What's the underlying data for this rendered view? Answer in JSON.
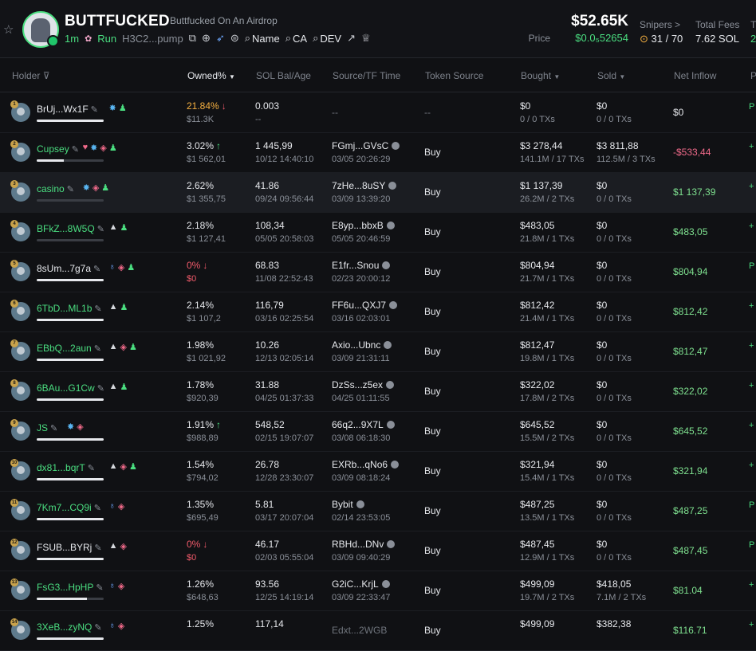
{
  "token": {
    "name": "BUTTFUCKED",
    "full_name": "Buttfucked On An Airdrop",
    "age": "1m",
    "run_label": "Run",
    "ca_short": "H3C2...pump",
    "links": {
      "name": "Name",
      "ca": "CA",
      "dev": "DEV"
    }
  },
  "stats": {
    "market_cap": "$52.65K",
    "price_label": "Price",
    "price_value": "$0.0₅52654",
    "snipers_label": "Snipers >",
    "snipers_value": "31 / 70",
    "fees_label": "Total Fees",
    "fees_value": "7.62 SOL",
    "cut_label": "T",
    "cut_value": "2"
  },
  "table": {
    "headers": {
      "holder": "Holder",
      "owned": "Owned%",
      "sol_bal": "SOL Bal/Age",
      "source": "Source/TF Time",
      "token_source": "Token Source",
      "bought": "Bought",
      "sold": "Sold",
      "net_inflow": "Net Inflow",
      "cut": "P"
    },
    "rows": [
      {
        "rank": "1",
        "name": "BrUj...Wx1F",
        "green": false,
        "bar": 100,
        "tags": [
          "t-blue",
          "t-person"
        ],
        "own": "21.84%",
        "own_cls": "own-orange",
        "own_arrow": "down",
        "own_usd": "$11.3K",
        "sol": "0.003",
        "age": "--",
        "src": "--",
        "tf_time": "",
        "tsrc": "--",
        "bought": "$0",
        "bought_sub": "0 / 0 TXs",
        "sold": "$0",
        "sold_sub": "0 / 0 TXs",
        "net": "$0",
        "net_cls": "net-zero",
        "edge": "P"
      },
      {
        "rank": "2",
        "name": "Cupsey",
        "green": true,
        "bar": 40,
        "tags": [
          "t-heart",
          "t-blue",
          "t-stack",
          "t-person"
        ],
        "own": "3.02%",
        "own_cls": "",
        "own_arrow": "up",
        "own_usd": "$1 562,01",
        "sol": "1 445,99",
        "age": "10/12 14:40:10",
        "src": "FGmj...GVsC",
        "tf_time": "03/05 20:26:29",
        "tsrc": "Buy",
        "bought": "$3 278,44",
        "bought_sub": "141.1M / 17 TXs",
        "sold": "$3 811,88",
        "sold_sub": "112.5M / 3 TXs",
        "net": "-$533,44",
        "net_cls": "net-neg",
        "edge": "+"
      },
      {
        "rank": "3",
        "name": "casino",
        "green": true,
        "bar": 0,
        "tags": [
          "t-blue",
          "t-stack",
          "t-person"
        ],
        "own": "2.62%",
        "own_cls": "",
        "own_arrow": "",
        "own_usd": "$1 355,75",
        "sol": "41.86",
        "age": "09/24 09:56:44",
        "src": "7zHe...8uSY",
        "tf_time": "03/09 13:39:20",
        "tsrc": "Buy",
        "bought": "$1 137,39",
        "bought_sub": "26.2M / 2 TXs",
        "sold": "$0",
        "sold_sub": "0 / 0 TXs",
        "net": "$1 137,39",
        "net_cls": "net-pos",
        "edge": "+"
      },
      {
        "rank": "4",
        "name": "BFkZ...8W5Q",
        "green": true,
        "bar": 0,
        "tags": [
          "t-cap",
          "t-person"
        ],
        "own": "2.18%",
        "own_cls": "",
        "own_arrow": "",
        "own_usd": "$1 127,41",
        "sol": "108,34",
        "age": "05/05 20:58:03",
        "src": "E8yp...bbxB",
        "tf_time": "05/05 20:46:59",
        "tsrc": "Buy",
        "bought": "$483,05",
        "bought_sub": "21.8M / 1 TXs",
        "sold": "$0",
        "sold_sub": "0 / 0 TXs",
        "net": "$483,05",
        "net_cls": "net-pos",
        "edge": "+"
      },
      {
        "rank": "5",
        "name": "8sUm...7g7a",
        "green": false,
        "bar": 100,
        "tags": [
          "t-ghost",
          "t-stack",
          "t-person"
        ],
        "own": "0%",
        "own_cls": "own-red",
        "own_arrow": "down",
        "own_usd": "$0",
        "own_usd_red": true,
        "sol": "68.83",
        "age": "11/08 22:52:43",
        "src": "E1fr...Snou",
        "tf_time": "02/23 20:00:12",
        "tsrc": "Buy",
        "bought": "$804,94",
        "bought_sub": "21.7M / 1 TXs",
        "sold": "$0",
        "sold_sub": "0 / 0 TXs",
        "net": "$804,94",
        "net_cls": "net-pos",
        "edge": "P"
      },
      {
        "rank": "6",
        "name": "6TbD...ML1b",
        "green": true,
        "bar": 100,
        "tags": [
          "t-cap",
          "t-person"
        ],
        "own": "2.14%",
        "own_cls": "",
        "own_arrow": "",
        "own_usd": "$1 107,2",
        "sol": "116,79",
        "age": "03/16 02:25:54",
        "src": "FF6u...QXJ7",
        "tf_time": "03/16 02:03:01",
        "tsrc": "Buy",
        "bought": "$812,42",
        "bought_sub": "21.4M / 1 TXs",
        "sold": "$0",
        "sold_sub": "0 / 0 TXs",
        "net": "$812,42",
        "net_cls": "net-pos",
        "edge": "+"
      },
      {
        "rank": "7",
        "name": "EBbQ...2aun",
        "green": true,
        "bar": 100,
        "tags": [
          "t-cap",
          "t-stack",
          "t-person"
        ],
        "own": "1.98%",
        "own_cls": "",
        "own_arrow": "",
        "own_usd": "$1 021,92",
        "sol": "10.26",
        "age": "12/13 02:05:14",
        "src": "Axio...Ubnc",
        "tf_time": "03/09 21:31:11",
        "tsrc": "Buy",
        "bought": "$812,47",
        "bought_sub": "19.8M / 1 TXs",
        "sold": "$0",
        "sold_sub": "0 / 0 TXs",
        "net": "$812,47",
        "net_cls": "net-pos",
        "edge": "+"
      },
      {
        "rank": "8",
        "name": "6BAu...G1Cw",
        "green": true,
        "bar": 100,
        "tags": [
          "t-cap",
          "t-person"
        ],
        "own": "1.78%",
        "own_cls": "",
        "own_arrow": "",
        "own_usd": "$920,39",
        "sol": "31.88",
        "age": "04/25 01:37:33",
        "src": "DzSs...z5ex",
        "tf_time": "04/25 01:11:55",
        "tsrc": "Buy",
        "bought": "$322,02",
        "bought_sub": "17.8M / 2 TXs",
        "sold": "$0",
        "sold_sub": "0 / 0 TXs",
        "net": "$322,02",
        "net_cls": "net-pos",
        "edge": "+"
      },
      {
        "rank": "9",
        "name": "JS",
        "green": true,
        "bar": 100,
        "tags": [
          "t-blue",
          "t-stack"
        ],
        "own": "1.91%",
        "own_cls": "",
        "own_arrow": "up",
        "own_usd": "$988,89",
        "sol": "548,52",
        "age": "02/15 19:07:07",
        "src": "66q2...9X7L",
        "tf_time": "03/08 06:18:30",
        "tsrc": "Buy",
        "bought": "$645,52",
        "bought_sub": "15.5M / 2 TXs",
        "sold": "$0",
        "sold_sub": "0 / 0 TXs",
        "net": "$645,52",
        "net_cls": "net-pos",
        "edge": "+"
      },
      {
        "rank": "10",
        "name": "dx81...bqrT",
        "green": true,
        "bar": 100,
        "tags": [
          "t-cap",
          "t-stack",
          "t-person"
        ],
        "own": "1.54%",
        "own_cls": "",
        "own_arrow": "",
        "own_usd": "$794,02",
        "sol": "26.78",
        "age": "12/28 23:30:07",
        "src": "EXRb...qNo6",
        "tf_time": "03/09 08:18:24",
        "tsrc": "Buy",
        "bought": "$321,94",
        "bought_sub": "15.4M / 1 TXs",
        "sold": "$0",
        "sold_sub": "0 / 0 TXs",
        "net": "$321,94",
        "net_cls": "net-pos",
        "edge": "+"
      },
      {
        "rank": "11",
        "name": "7Km7...CQ9i",
        "green": true,
        "bar": 100,
        "tags": [
          "t-ghost",
          "t-stack"
        ],
        "own": "1.35%",
        "own_cls": "",
        "own_arrow": "",
        "own_usd": "$695,49",
        "sol": "5.81",
        "age": "03/17 20:07:04",
        "src": "Bybit",
        "tf_time": "02/14 23:53:05",
        "tsrc": "Buy",
        "bought": "$487,25",
        "bought_sub": "13.5M / 1 TXs",
        "sold": "$0",
        "sold_sub": "0 / 0 TXs",
        "net": "$487,25",
        "net_cls": "net-pos",
        "edge": "P"
      },
      {
        "rank": "12",
        "name": "FSUB...BYRj",
        "green": false,
        "bar": 100,
        "tags": [
          "t-cap",
          "t-stack"
        ],
        "own": "0%",
        "own_cls": "own-red",
        "own_arrow": "down",
        "own_usd": "$0",
        "own_usd_red": true,
        "sol": "46.17",
        "age": "02/03 05:55:04",
        "src": "RBHd...DNv",
        "tf_time": "03/09 09:40:29",
        "tsrc": "Buy",
        "bought": "$487,45",
        "bought_sub": "12.9M / 1 TXs",
        "sold": "$0",
        "sold_sub": "0 / 0 TXs",
        "net": "$487,45",
        "net_cls": "net-pos",
        "edge": "P"
      },
      {
        "rank": "13",
        "name": "FsG3...HpHP",
        "green": true,
        "bar": 75,
        "tags": [
          "t-ghost",
          "t-stack"
        ],
        "own": "1.26%",
        "own_cls": "",
        "own_arrow": "",
        "own_usd": "$648,63",
        "sol": "93.56",
        "age": "12/25 14:19:14",
        "src": "G2iC...KrjL",
        "tf_time": "03/09 22:33:47",
        "tsrc": "Buy",
        "bought": "$499,09",
        "bought_sub": "19.7M / 2 TXs",
        "sold": "$418,05",
        "sold_sub": "7.1M / 2 TXs",
        "net": "$81.04",
        "net_cls": "net-pos",
        "edge": "+"
      },
      {
        "rank": "14",
        "name": "3XeB...zyNQ",
        "green": true,
        "bar": 100,
        "tags": [
          "t-ghost",
          "t-stack"
        ],
        "own": "1.25%",
        "own_cls": "",
        "own_arrow": "",
        "own_usd": "",
        "sol": "117,14",
        "age": "",
        "src": "Edxt...2WGB",
        "tf_time": "",
        "tsrc": "Buy",
        "bought": "$499,09",
        "bought_sub": "",
        "sold": "$382,38",
        "sold_sub": "",
        "net": "$116.71",
        "net_cls": "net-pos",
        "edge": "+"
      }
    ]
  }
}
